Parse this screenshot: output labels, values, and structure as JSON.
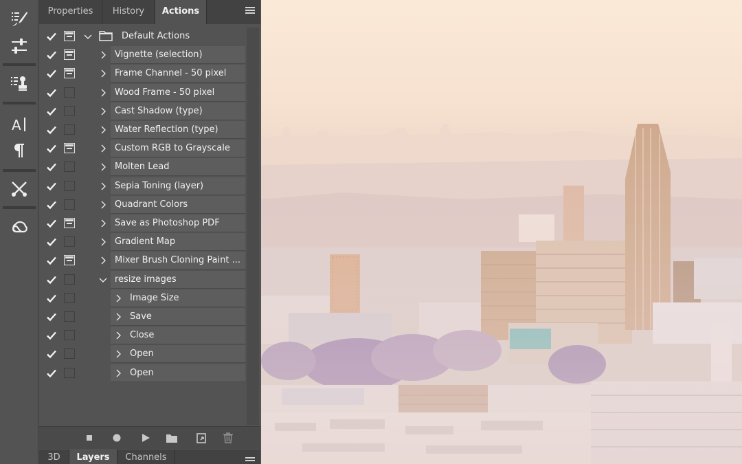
{
  "panel": {
    "tabs": [
      {
        "label": "Properties",
        "active": false
      },
      {
        "label": "History",
        "active": false
      },
      {
        "label": "Actions",
        "active": true
      }
    ],
    "bottom_tabs": [
      {
        "label": "3D",
        "active": false
      },
      {
        "label": "Layers",
        "active": true
      },
      {
        "label": "Channels",
        "active": false
      }
    ]
  },
  "actions": [
    {
      "label": "Default Actions",
      "level": 0,
      "checked": true,
      "dialog": true,
      "expanded": true,
      "type": "set"
    },
    {
      "label": "Vignette (selection)",
      "level": 1,
      "checked": true,
      "dialog": true,
      "expanded": false
    },
    {
      "label": "Frame Channel - 50 pixel",
      "level": 1,
      "checked": true,
      "dialog": true,
      "expanded": false
    },
    {
      "label": "Wood Frame - 50 pixel",
      "level": 1,
      "checked": true,
      "dialog": false,
      "expanded": false
    },
    {
      "label": "Cast Shadow (type)",
      "level": 1,
      "checked": true,
      "dialog": false,
      "expanded": false
    },
    {
      "label": "Water Reflection (type)",
      "level": 1,
      "checked": true,
      "dialog": false,
      "expanded": false
    },
    {
      "label": "Custom RGB to Grayscale",
      "level": 1,
      "checked": true,
      "dialog": true,
      "expanded": false
    },
    {
      "label": "Molten Lead",
      "level": 1,
      "checked": true,
      "dialog": false,
      "expanded": false
    },
    {
      "label": "Sepia Toning (layer)",
      "level": 1,
      "checked": true,
      "dialog": false,
      "expanded": false
    },
    {
      "label": "Quadrant Colors",
      "level": 1,
      "checked": true,
      "dialog": false,
      "expanded": false
    },
    {
      "label": "Save as Photoshop PDF",
      "level": 1,
      "checked": true,
      "dialog": true,
      "expanded": false
    },
    {
      "label": "Gradient Map",
      "level": 1,
      "checked": true,
      "dialog": false,
      "expanded": false
    },
    {
      "label": "Mixer Brush Cloning Paint ...",
      "level": 1,
      "checked": true,
      "dialog": true,
      "expanded": false
    },
    {
      "label": "resize images",
      "level": 1,
      "checked": true,
      "dialog": false,
      "expanded": true
    },
    {
      "label": "Image Size",
      "level": 2,
      "checked": true,
      "dialog": false,
      "expanded": false
    },
    {
      "label": "Save",
      "level": 2,
      "checked": true,
      "dialog": false,
      "expanded": false
    },
    {
      "label": "Close",
      "level": 2,
      "checked": true,
      "dialog": false,
      "expanded": false
    },
    {
      "label": "Open",
      "level": 2,
      "checked": true,
      "dialog": false,
      "expanded": false
    },
    {
      "label": "Open",
      "level": 2,
      "checked": true,
      "dialog": false,
      "expanded": false
    }
  ],
  "bottom_buttons": [
    "stop-icon",
    "record-icon",
    "play-icon",
    "new-set-icon",
    "new-action-icon",
    "delete-icon"
  ],
  "tools": [
    "paragraph-styles-icon",
    "adjustments-icon",
    "clone-source-icon",
    "character-icon",
    "paragraph-icon",
    "tool-presets-icon",
    "creative-cloud-icon"
  ],
  "colors": {
    "panel_bg": "#535353",
    "row_bg": "#5d5d5d",
    "text": "#f0f0f0",
    "tab_bar": "#424242"
  }
}
